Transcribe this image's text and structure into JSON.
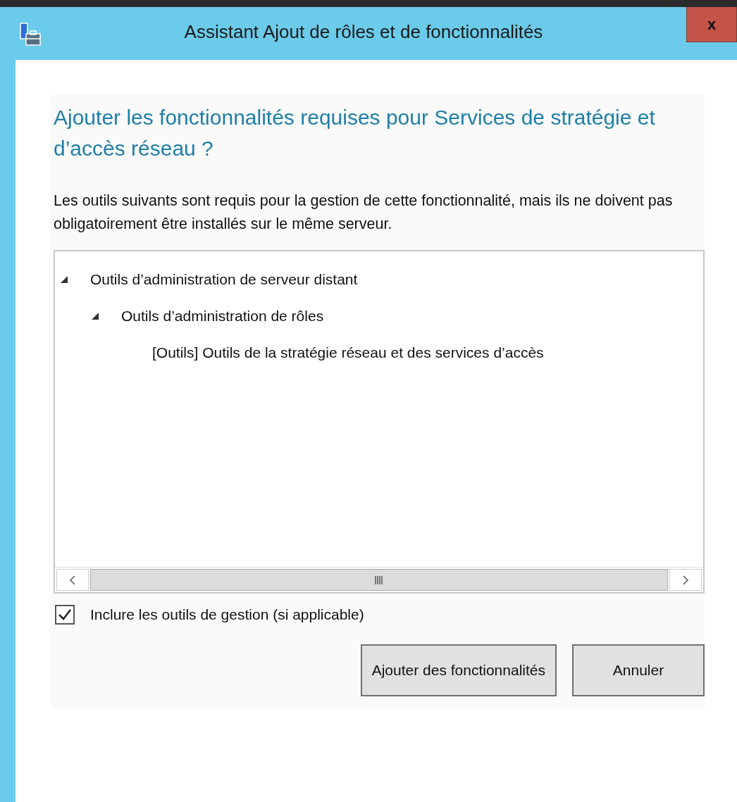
{
  "window": {
    "title": "Assistant Ajout de rôles et de fonctionnalités",
    "close": "x"
  },
  "heading": "Ajouter les fonctionnalités requises pour Services de stratégie et d’accès réseau ?",
  "description": "Les outils suivants sont requis pour la gestion de cette fonctionnalité, mais ils ne doivent pas obligatoirement être installés sur le même serveur.",
  "tree": [
    {
      "label": "Outils d’administration de serveur distant",
      "expanded": true,
      "children": [
        {
          "label": "Outils d’administration de rôles",
          "expanded": true,
          "children": [
            {
              "label": "[Outils] Outils de la stratégie réseau et des services d’accès"
            }
          ]
        }
      ]
    }
  ],
  "include_tools": {
    "label": "Inclure les outils de gestion (si applicable)",
    "checked": true
  },
  "buttons": [
    {
      "label": "Ajouter des fonctionnalités"
    },
    {
      "label": "Annuler"
    }
  ]
}
